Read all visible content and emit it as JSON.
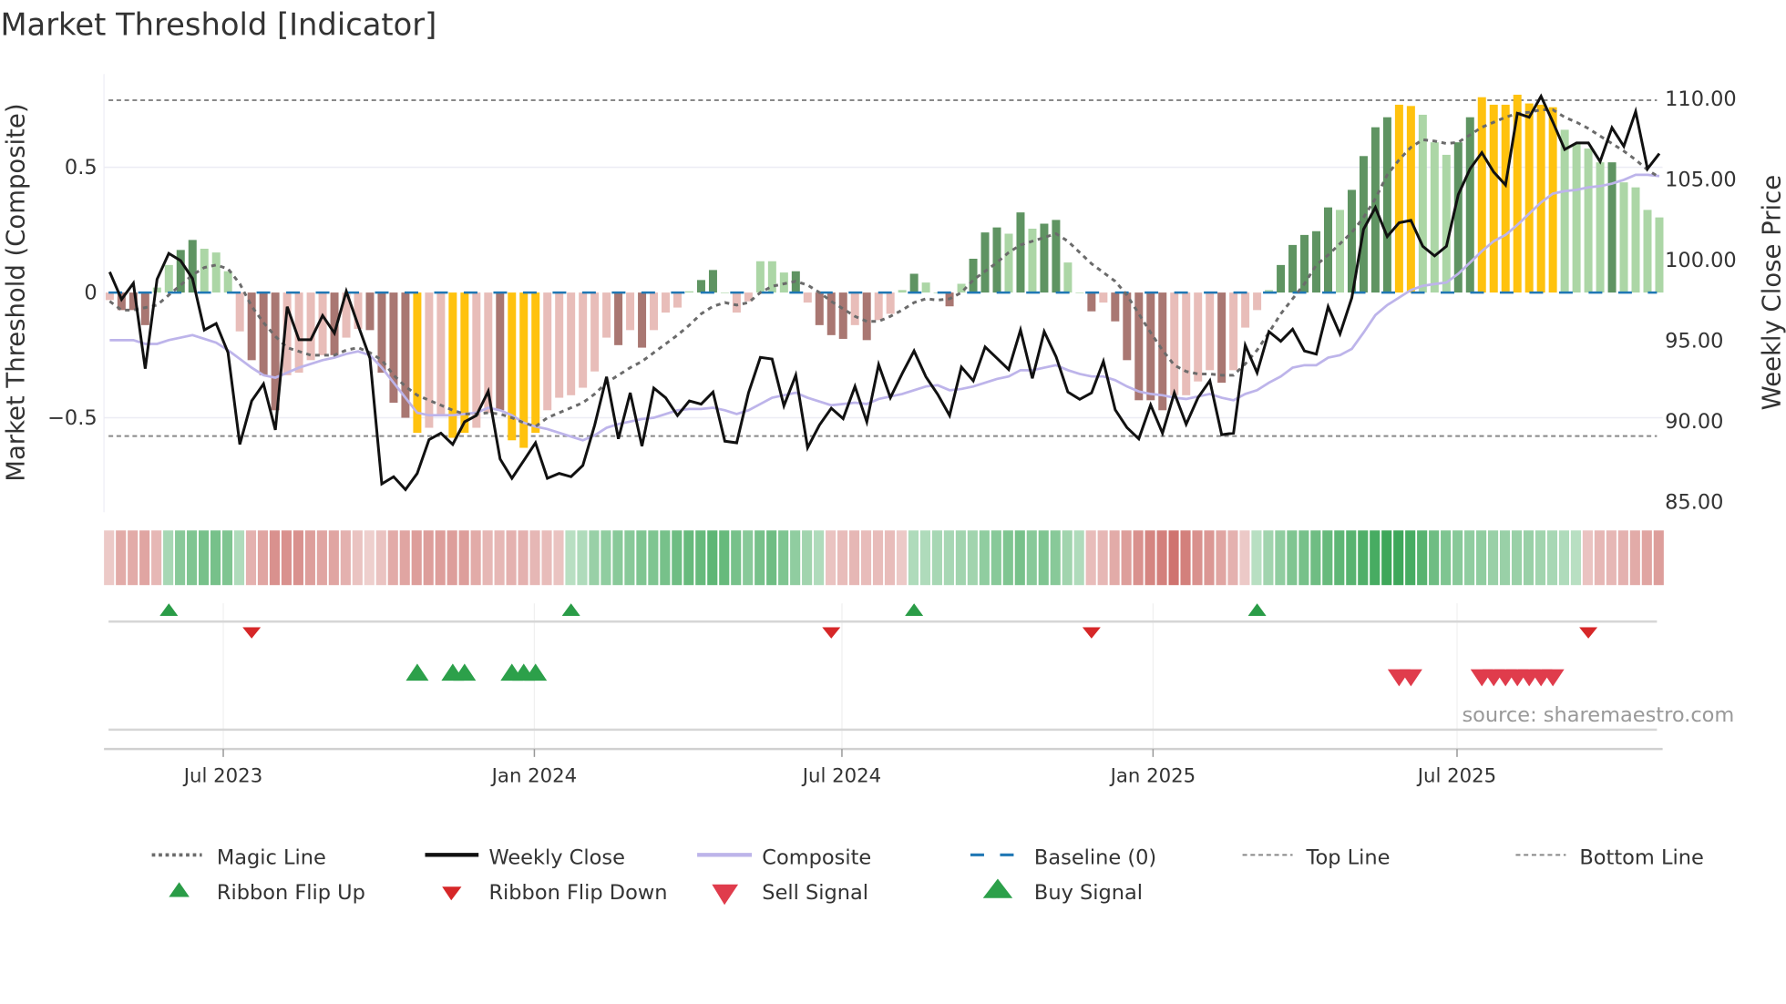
{
  "title": "Market Threshold [Indicator]",
  "source": "source: sharemaestro.com",
  "colors": {
    "dark_green": "#5f9462",
    "light_green": "#acd6a6",
    "dark_red": "#a97772",
    "light_red": "#e8bdb9",
    "gold": "#ffc20e",
    "close": "#111111",
    "composite": "#bdb4ea",
    "magic": "#6b6b6b",
    "baseline": "#1f77b4",
    "threshold": "#888888",
    "ribbon_green": "#2ea04c",
    "ribbon_red": "#c8605b",
    "flip_up": "#2a9c47",
    "flip_down": "#d62728",
    "sell": "#e03c4c",
    "buy": "#2ca04a"
  },
  "chart_data": {
    "type": "bar+line",
    "title": "Market Threshold [Indicator]",
    "ylabel_left": "Market Threshold (Composite)",
    "ylabel_right": "Weekly Close Price",
    "left_ticks": [
      {
        "v": 0.5,
        "label": "0.5"
      },
      {
        "v": 0,
        "label": "0"
      },
      {
        "v": -0.5,
        "label": "−0.5"
      }
    ],
    "right_ticks": [
      {
        "v": 110,
        "label": "110.00"
      },
      {
        "v": 105,
        "label": "105.00"
      },
      {
        "v": 100,
        "label": "100.00"
      },
      {
        "v": 95,
        "label": "95.00"
      },
      {
        "v": 90,
        "label": "90.00"
      },
      {
        "v": 85,
        "label": "85.00"
      }
    ],
    "x_ticks": [
      {
        "week": 9.6,
        "label": "Jul 2023"
      },
      {
        "week": 35.9,
        "label": "Jan 2024"
      },
      {
        "week": 61.9,
        "label": "Jul 2024"
      },
      {
        "week": 88.2,
        "label": "Jan 2025"
      },
      {
        "week": 113.9,
        "label": "Jul 2025"
      }
    ],
    "left_range": [
      -0.87,
      0.87
    ],
    "right_range": [
      83.2,
      113.0
    ],
    "top_line": 0.768,
    "bottom_line": -0.573,
    "baseline": 0,
    "bar_colors": [
      "lr",
      "dr",
      "dr",
      "dr",
      "lg",
      "lg",
      "dg",
      "dg",
      "lg",
      "lg",
      "lg",
      "lr",
      "dr",
      "dr",
      "dr",
      "lr",
      "lr",
      "lr",
      "lr",
      "dr",
      "lr",
      "lr",
      "dr",
      "dr",
      "dr",
      "dr",
      "au",
      "lr",
      "lr",
      "au",
      "au",
      "lr",
      "lr",
      "dr",
      "au",
      "au",
      "au",
      "lr",
      "lr",
      "lr",
      "lr",
      "lr",
      "lr",
      "dr",
      "lr",
      "dr",
      "lr",
      "lr",
      "lr",
      "lg",
      "dg",
      "dg",
      "lg",
      "lr",
      "lr",
      "lg",
      "lg",
      "lg",
      "dg",
      "lr",
      "dr",
      "dr",
      "dr",
      "lr",
      "dr",
      "lr",
      "lr",
      "lg",
      "dg",
      "lg",
      "lg",
      "dr",
      "lg",
      "dg",
      "dg",
      "dg",
      "lg",
      "dg",
      "lg",
      "dg",
      "dg",
      "lg",
      "lg",
      "dr",
      "lr",
      "dr",
      "dr",
      "dr",
      "dr",
      "dr",
      "lr",
      "lr",
      "lr",
      "lr",
      "dr",
      "lr",
      "lr",
      "lr",
      "lg",
      "dg",
      "dg",
      "dg",
      "dg",
      "dg",
      "lg",
      "dg",
      "dg",
      "dg",
      "dg",
      "au",
      "au",
      "lg",
      "lg",
      "lg",
      "dg",
      "dg",
      "au",
      "au",
      "au",
      "au",
      "au",
      "au",
      "au",
      "lg",
      "lg",
      "lg",
      "lg",
      "dg",
      "lg",
      "lg",
      "lg",
      "lg"
    ],
    "composite_bars": [
      -0.03,
      -0.07,
      -0.07,
      -0.13,
      0.02,
      0.11,
      0.17,
      0.21,
      0.175,
      0.16,
      0.085,
      -0.155,
      -0.27,
      -0.33,
      -0.47,
      -0.33,
      -0.32,
      -0.27,
      -0.25,
      -0.25,
      -0.18,
      -0.145,
      -0.15,
      -0.32,
      -0.44,
      -0.5,
      -0.56,
      -0.54,
      -0.49,
      -0.58,
      -0.56,
      -0.54,
      -0.48,
      -0.47,
      -0.59,
      -0.62,
      -0.56,
      -0.47,
      -0.42,
      -0.41,
      -0.38,
      -0.315,
      -0.18,
      -0.21,
      -0.15,
      -0.22,
      -0.15,
      -0.08,
      -0.06,
      0.005,
      0.05,
      0.09,
      0.0,
      -0.08,
      -0.035,
      0.125,
      0.125,
      0.08,
      0.085,
      -0.04,
      -0.13,
      -0.17,
      -0.185,
      -0.13,
      -0.19,
      -0.11,
      -0.085,
      0.01,
      0.075,
      0.04,
      0.0,
      -0.055,
      0.035,
      0.135,
      0.24,
      0.26,
      0.235,
      0.32,
      0.255,
      0.275,
      0.29,
      0.12,
      0.0,
      -0.075,
      -0.04,
      -0.115,
      -0.27,
      -0.43,
      -0.43,
      -0.47,
      -0.41,
      -0.41,
      -0.355,
      -0.31,
      -0.36,
      -0.31,
      -0.14,
      -0.07,
      0.01,
      0.11,
      0.19,
      0.23,
      0.245,
      0.34,
      0.33,
      0.41,
      0.545,
      0.66,
      0.7,
      0.75,
      0.745,
      0.71,
      0.6,
      0.55,
      0.6,
      0.7,
      0.78,
      0.75,
      0.75,
      0.79,
      0.755,
      0.75,
      0.74,
      0.65,
      0.595,
      0.575,
      0.52,
      0.52,
      0.44,
      0.42,
      0.33,
      0.3
    ],
    "magic_line": [
      -0.035,
      -0.07,
      -0.07,
      -0.06,
      -0.05,
      -0.01,
      0.03,
      0.07,
      0.1,
      0.11,
      0.095,
      0.035,
      -0.055,
      -0.12,
      -0.175,
      -0.22,
      -0.235,
      -0.25,
      -0.25,
      -0.25,
      -0.23,
      -0.22,
      -0.24,
      -0.27,
      -0.33,
      -0.375,
      -0.41,
      -0.43,
      -0.45,
      -0.47,
      -0.485,
      -0.485,
      -0.48,
      -0.485,
      -0.5,
      -0.52,
      -0.535,
      -0.5,
      -0.48,
      -0.46,
      -0.44,
      -0.405,
      -0.36,
      -0.33,
      -0.3,
      -0.275,
      -0.24,
      -0.205,
      -0.17,
      -0.13,
      -0.085,
      -0.055,
      -0.04,
      -0.05,
      -0.04,
      0.0,
      0.025,
      0.035,
      0.045,
      0.03,
      0.0,
      -0.035,
      -0.065,
      -0.095,
      -0.115,
      -0.115,
      -0.095,
      -0.07,
      -0.04,
      -0.025,
      -0.03,
      -0.025,
      0.0,
      0.05,
      0.085,
      0.12,
      0.16,
      0.19,
      0.205,
      0.22,
      0.235,
      0.205,
      0.16,
      0.115,
      0.08,
      0.045,
      -0.01,
      -0.085,
      -0.16,
      -0.23,
      -0.29,
      -0.315,
      -0.325,
      -0.325,
      -0.33,
      -0.33,
      -0.285,
      -0.23,
      -0.16,
      -0.085,
      -0.025,
      0.035,
      0.11,
      0.15,
      0.195,
      0.24,
      0.3,
      0.375,
      0.47,
      0.53,
      0.58,
      0.61,
      0.605,
      0.595,
      0.6,
      0.63,
      0.66,
      0.68,
      0.7,
      0.715,
      0.72,
      0.73,
      0.73,
      0.7,
      0.68,
      0.655,
      0.625,
      0.595,
      0.565,
      0.53,
      0.49,
      0.46
    ],
    "composite_line": [
      -0.19,
      -0.19,
      -0.19,
      -0.205,
      -0.205,
      -0.19,
      -0.18,
      -0.17,
      -0.185,
      -0.2,
      -0.23,
      -0.265,
      -0.3,
      -0.33,
      -0.34,
      -0.32,
      -0.3,
      -0.285,
      -0.27,
      -0.26,
      -0.245,
      -0.235,
      -0.25,
      -0.3,
      -0.36,
      -0.42,
      -0.48,
      -0.49,
      -0.49,
      -0.49,
      -0.485,
      -0.48,
      -0.46,
      -0.47,
      -0.49,
      -0.52,
      -0.535,
      -0.545,
      -0.56,
      -0.575,
      -0.59,
      -0.57,
      -0.54,
      -0.525,
      -0.515,
      -0.505,
      -0.5,
      -0.485,
      -0.47,
      -0.465,
      -0.465,
      -0.46,
      -0.47,
      -0.485,
      -0.47,
      -0.445,
      -0.42,
      -0.41,
      -0.4,
      -0.42,
      -0.435,
      -0.45,
      -0.445,
      -0.44,
      -0.445,
      -0.425,
      -0.415,
      -0.405,
      -0.39,
      -0.375,
      -0.37,
      -0.39,
      -0.385,
      -0.375,
      -0.36,
      -0.345,
      -0.335,
      -0.31,
      -0.31,
      -0.3,
      -0.29,
      -0.31,
      -0.325,
      -0.335,
      -0.335,
      -0.35,
      -0.375,
      -0.395,
      -0.405,
      -0.41,
      -0.42,
      -0.425,
      -0.415,
      -0.405,
      -0.42,
      -0.43,
      -0.405,
      -0.39,
      -0.36,
      -0.335,
      -0.3,
      -0.29,
      -0.29,
      -0.26,
      -0.25,
      -0.225,
      -0.16,
      -0.09,
      -0.05,
      -0.02,
      0.01,
      0.027,
      0.034,
      0.04,
      0.075,
      0.12,
      0.165,
      0.205,
      0.23,
      0.27,
      0.315,
      0.36,
      0.395,
      0.405,
      0.41,
      0.42,
      0.425,
      0.435,
      0.45,
      0.47,
      0.47,
      0.465
    ],
    "weekly_close": [
      99.2,
      97.5,
      98.5,
      93.2,
      98.75,
      100.35,
      99.9,
      98.8,
      95.6,
      96.0,
      94.2,
      88.5,
      91.2,
      92.25,
      89.4,
      97.05,
      95.0,
      95.0,
      96.5,
      95.4,
      98.0,
      95.9,
      93.85,
      86.05,
      86.5,
      85.7,
      86.7,
      88.8,
      89.2,
      88.5,
      89.9,
      90.3,
      91.8,
      87.6,
      86.4,
      87.5,
      88.6,
      86.4,
      86.7,
      86.5,
      87.2,
      89.7,
      92.7,
      88.85,
      91.7,
      88.4,
      92.0,
      91.4,
      90.3,
      91.2,
      91.0,
      91.75,
      88.7,
      88.6,
      91.7,
      93.9,
      93.8,
      90.9,
      92.8,
      88.3,
      89.7,
      90.75,
      90.1,
      92.1,
      89.9,
      93.45,
      91.4,
      92.9,
      94.3,
      92.7,
      91.6,
      90.3,
      93.3,
      92.45,
      94.55,
      93.85,
      93.15,
      95.6,
      92.6,
      95.5,
      93.95,
      91.75,
      91.3,
      91.7,
      93.65,
      90.65,
      89.55,
      88.85,
      90.95,
      89.2,
      91.7,
      89.75,
      91.4,
      92.45,
      89.1,
      89.2,
      94.65,
      92.95,
      95.5,
      94.9,
      95.65,
      94.3,
      94.1,
      97.05,
      95.35,
      97.6,
      101.85,
      103.2,
      101.4,
      102.25,
      102.4,
      100.8,
      100.2,
      100.8,
      104.0,
      105.6,
      106.6,
      105.4,
      104.6,
      109.05,
      108.8,
      110.1,
      108.5,
      106.8,
      107.2,
      107.2,
      106.05,
      108.15,
      107.0,
      109.15,
      105.6,
      106.55
    ],
    "ribbon_strength": [
      -0.15,
      -0.4,
      -0.4,
      -0.45,
      -0.3,
      0.25,
      0.45,
      0.5,
      0.55,
      0.55,
      0.5,
      0.2,
      -0.35,
      -0.45,
      -0.6,
      -0.6,
      -0.6,
      -0.5,
      -0.45,
      -0.45,
      -0.35,
      -0.2,
      -0.1,
      -0.2,
      -0.4,
      -0.45,
      -0.5,
      -0.5,
      -0.5,
      -0.5,
      -0.5,
      -0.4,
      -0.3,
      -0.3,
      -0.35,
      -0.35,
      -0.3,
      -0.25,
      -0.2,
      0.15,
      0.2,
      0.35,
      0.4,
      0.45,
      0.45,
      0.5,
      0.5,
      0.55,
      0.6,
      0.65,
      0.65,
      0.7,
      0.65,
      0.55,
      0.45,
      0.55,
      0.6,
      0.5,
      0.4,
      0.3,
      0.2,
      -0.2,
      -0.25,
      -0.3,
      -0.25,
      -0.25,
      -0.25,
      -0.15,
      0.2,
      0.2,
      0.25,
      0.25,
      0.3,
      0.3,
      0.4,
      0.45,
      0.5,
      0.55,
      0.45,
      0.5,
      0.45,
      0.3,
      0.2,
      -0.25,
      -0.3,
      -0.4,
      -0.5,
      -0.6,
      -0.7,
      -0.75,
      -0.85,
      -0.75,
      -0.6,
      -0.55,
      -0.45,
      -0.35,
      -0.15,
      0.15,
      0.3,
      0.4,
      0.5,
      0.55,
      0.6,
      0.65,
      0.7,
      0.75,
      0.8,
      0.85,
      0.9,
      0.9,
      0.85,
      0.75,
      0.6,
      0.5,
      0.45,
      0.4,
      0.4,
      0.35,
      0.35,
      0.35,
      0.35,
      0.3,
      0.25,
      0.2,
      0.15,
      -0.2,
      -0.3,
      -0.3,
      -0.35,
      -0.4,
      -0.45,
      -0.5
    ],
    "ribbon_flip_up_weeks": [
      5,
      39,
      68,
      97
    ],
    "ribbon_flip_down_weeks": [
      12,
      61,
      83,
      125
    ],
    "buy_signal_weeks": [
      26,
      29,
      30,
      34,
      35,
      36
    ],
    "sell_signal_weeks": [
      109,
      110,
      116,
      117,
      118,
      119,
      120,
      121,
      122
    ],
    "legend": {
      "magic": "Magic Line",
      "close": "Weekly Close",
      "composite": "Composite",
      "baseline": "Baseline (0)",
      "top": "Top Line",
      "bottom": "Bottom Line",
      "flip_up": "Ribbon Flip Up",
      "flip_down": "Ribbon Flip Down",
      "sell": "Sell Signal",
      "buy": "Buy Signal"
    },
    "legend_placement": "bottom"
  }
}
